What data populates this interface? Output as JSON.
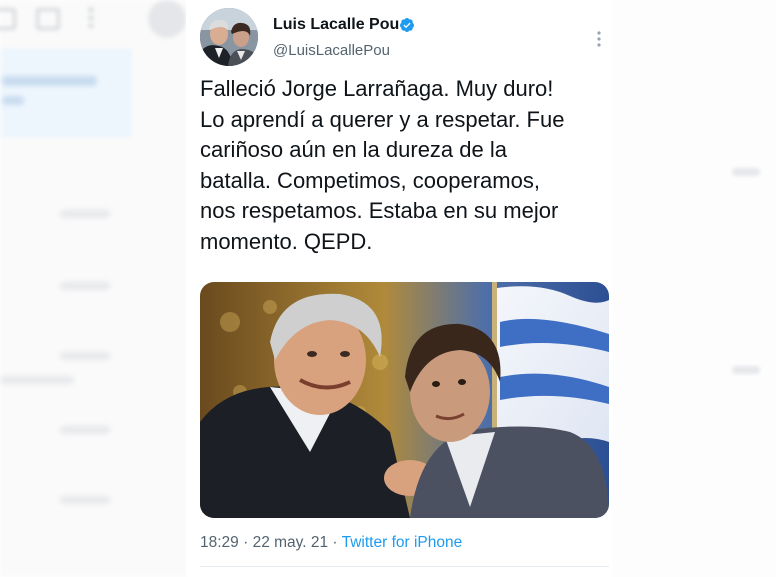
{
  "tweet": {
    "author": {
      "name": "Luis Lacalle Pou",
      "handle": "@LuisLacallePou",
      "verified": true
    },
    "text_lines": [
      "Falleció Jorge Larrañaga. Muy duro!",
      "Lo aprendí a querer y a respetar. Fue",
      "cariñoso aún en la dureza de la",
      "batalla. Competimos, cooperamos,",
      "nos respetamos. Estaba en su mejor",
      "momento. QEPD."
    ],
    "time": "18:29",
    "separator": " · ",
    "date": "22 may. 21",
    "source": "Twitter for iPhone"
  },
  "colors": {
    "text": "#0f1419",
    "secondary": "#536471",
    "link": "#1d9bf0",
    "verified": "#1d9bf0"
  },
  "icons": {
    "verified": "verified-badge-icon",
    "more": "more-options-icon"
  }
}
